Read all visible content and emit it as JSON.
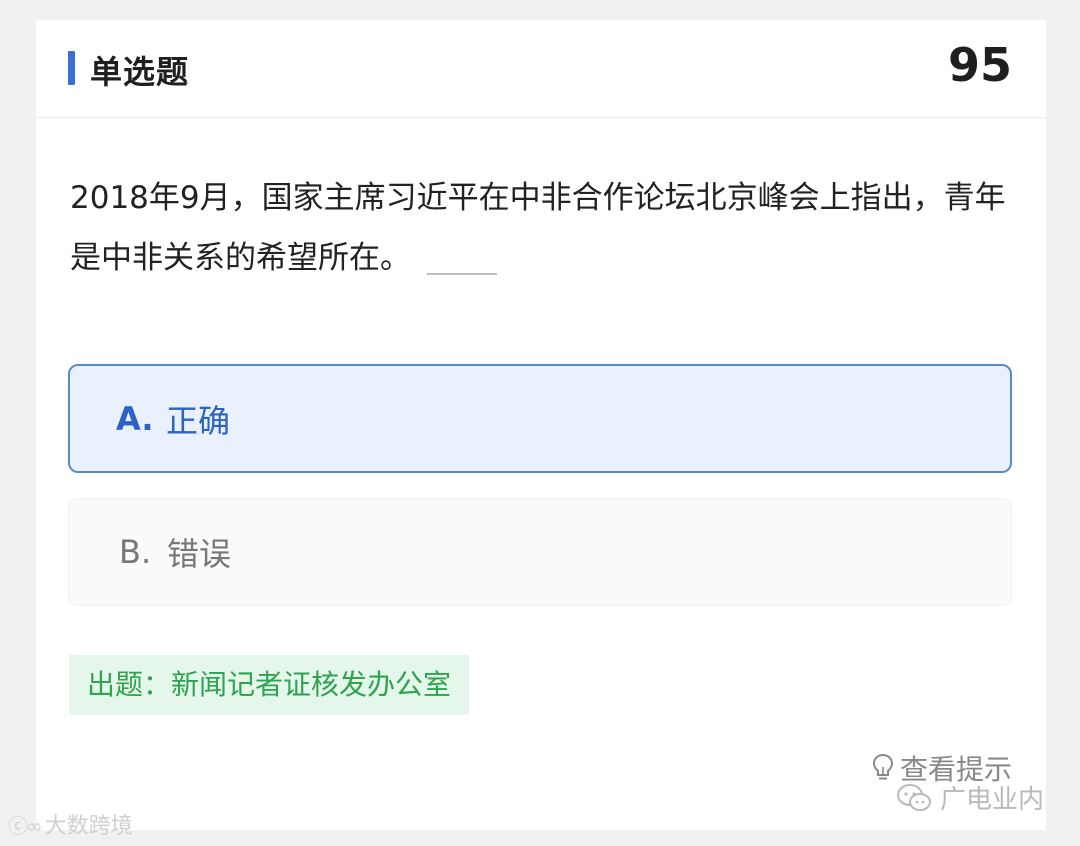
{
  "header": {
    "title": "单选题",
    "number": "95",
    "accent_color": "#3b6fd3"
  },
  "question": {
    "text": "2018年9月，国家主席习近平在中非合作论坛北京峰会上指出，青年是中非关系的希望所在。"
  },
  "options": [
    {
      "letter": "A.",
      "text": "正确",
      "selected": true
    },
    {
      "letter": "B.",
      "text": "错误",
      "selected": false
    }
  ],
  "source": {
    "text": "出题：新闻记者证核发办公室"
  },
  "hint": {
    "label": "查看提示",
    "icon": "lightbulb-icon"
  },
  "watermarks": {
    "right": "广电业内",
    "left": "大数跨境"
  }
}
